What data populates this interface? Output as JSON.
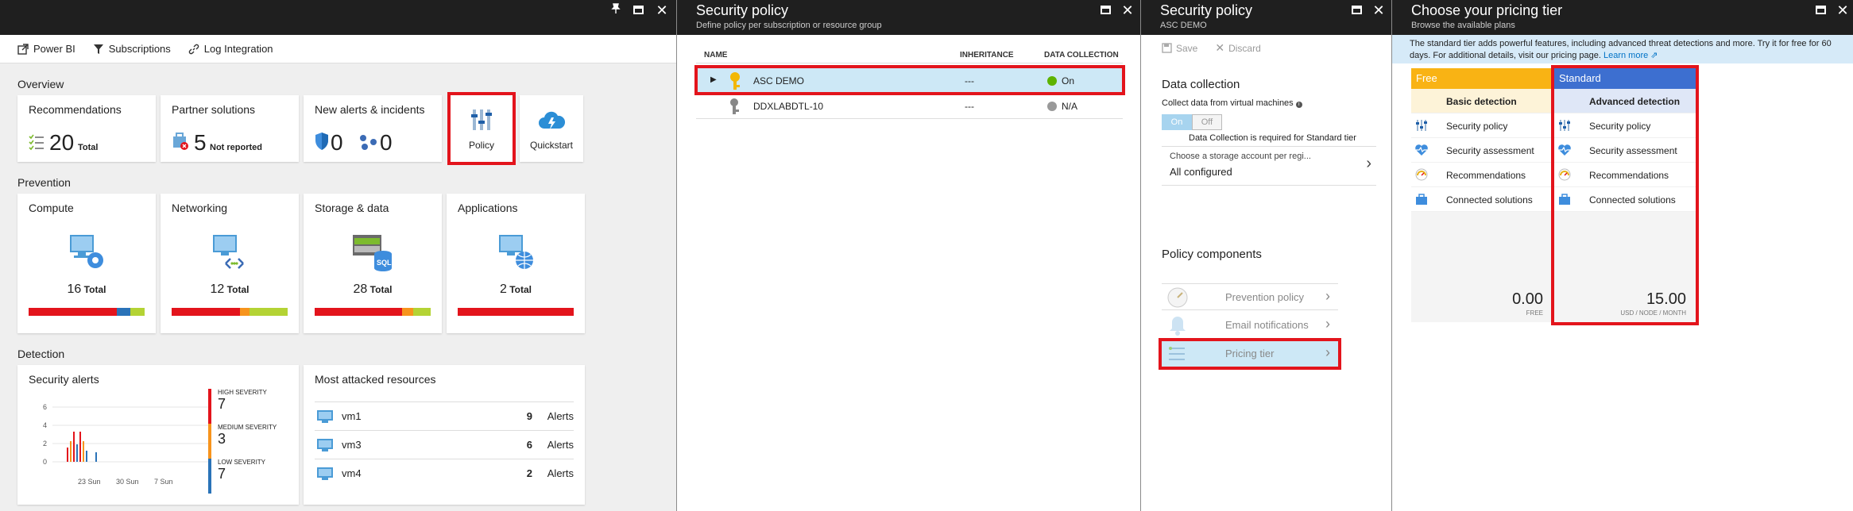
{
  "overview_blade": {
    "toolbar": [
      {
        "icon": "external-link-icon",
        "label": "Power BI"
      },
      {
        "icon": "filter-icon",
        "label": "Subscriptions"
      },
      {
        "icon": "link-icon",
        "label": "Log Integration"
      }
    ],
    "overview_label": "Overview",
    "recommendations": {
      "title": "Recommendations",
      "count": "20",
      "suffix": "Total"
    },
    "partner": {
      "title": "Partner solutions",
      "count": "5",
      "suffix": "Not reported"
    },
    "alerts": {
      "title": "New alerts & incidents",
      "alerts_count": "0",
      "incidents_count": "0"
    },
    "policy_tile": {
      "label": "Policy"
    },
    "quickstart_tile": {
      "label": "Quickstart"
    },
    "prevention_label": "Prevention",
    "prevention_tiles": [
      {
        "title": "Compute",
        "count": "16",
        "suffix": "Total",
        "icon": "compute-icon"
      },
      {
        "title": "Networking",
        "count": "12",
        "suffix": "Total",
        "icon": "networking-icon"
      },
      {
        "title": "Storage & data",
        "count": "28",
        "suffix": "Total",
        "icon": "sql-storage-icon"
      },
      {
        "title": "Applications",
        "count": "2",
        "suffix": "Total",
        "icon": "applications-icon"
      }
    ],
    "severity_bars": [
      {
        "red": 0.76,
        "orange": 0,
        "blue": 0.12,
        "green": 0.12
      },
      {
        "red": 0.59,
        "orange": 0.08,
        "blue": 0,
        "green": 0.33
      },
      {
        "red": 0.75,
        "orange": 0.1,
        "blue": 0,
        "green": 0.15
      },
      {
        "red": 1.0,
        "orange": 0,
        "blue": 0,
        "green": 0
      }
    ],
    "detection_label": "Detection",
    "security_alerts": {
      "title": "Security alerts",
      "y_ticks": [
        "6",
        "4",
        "2",
        "0"
      ],
      "x_ticks": [
        "23 Sun",
        "30 Sun",
        "7 Sun"
      ],
      "severity": [
        {
          "label": "HIGH SEVERITY",
          "value": "7",
          "color": "#e3141c"
        },
        {
          "label": "MEDIUM SEVERITY",
          "value": "3",
          "color": "#f7941d"
        },
        {
          "label": "LOW SEVERITY",
          "value": "7",
          "color": "#2a73b8"
        }
      ]
    },
    "attacked": {
      "title": "Most attacked resources",
      "rows": [
        {
          "name": "vm1",
          "count": "9",
          "unit": "Alerts"
        },
        {
          "name": "vm3",
          "count": "6",
          "unit": "Alerts"
        },
        {
          "name": "vm4",
          "count": "2",
          "unit": "Alerts"
        }
      ]
    }
  },
  "policy_blade": {
    "title": "Security policy",
    "subtitle": "Define policy per subscription or resource group",
    "columns": [
      "NAME",
      "INHERITANCE",
      "DATA COLLECTION"
    ],
    "rows": [
      {
        "name": "ASC DEMO",
        "inheritance": "---",
        "collection": "On",
        "status_color": "#5db300"
      },
      {
        "name": "DDXLABDTL-10",
        "inheritance": "---",
        "collection": "N/A",
        "status_color": "#999999"
      }
    ]
  },
  "asc_blade": {
    "title": "Security policy",
    "subtitle": "ASC DEMO",
    "save_label": "Save",
    "discard_label": "Discard",
    "data_collection_heading": "Data collection",
    "collect_label": "Collect data from virtual machines",
    "toggle_on": "On",
    "toggle_off": "Off",
    "standard_note": "Data Collection is required for Standard tier",
    "storage_label": "Choose a storage account per regi...",
    "storage_value": "All configured",
    "components_heading": "Policy components",
    "components": [
      "Prevention policy",
      "Email notifications",
      "Pricing tier"
    ]
  },
  "pricing_blade": {
    "title": "Choose your pricing tier",
    "subtitle": "Browse the available plans",
    "info_text": "The standard tier adds powerful features, including advanced threat detections and more. Try it for free for 60 days. For additional details, visit our pricing page.",
    "learn_more": "Learn more",
    "plans": [
      {
        "name": "Free",
        "color": "#f9b314",
        "detection": "Basic detection",
        "price": "0.00",
        "unit": "FREE"
      },
      {
        "name": "Standard",
        "color": "#3d6fd0",
        "detection": "Advanced detection",
        "price": "15.00",
        "unit": "USD / NODE / MONTH"
      }
    ],
    "features": [
      "Security policy",
      "Security assessment",
      "Recommendations",
      "Connected solutions"
    ]
  }
}
